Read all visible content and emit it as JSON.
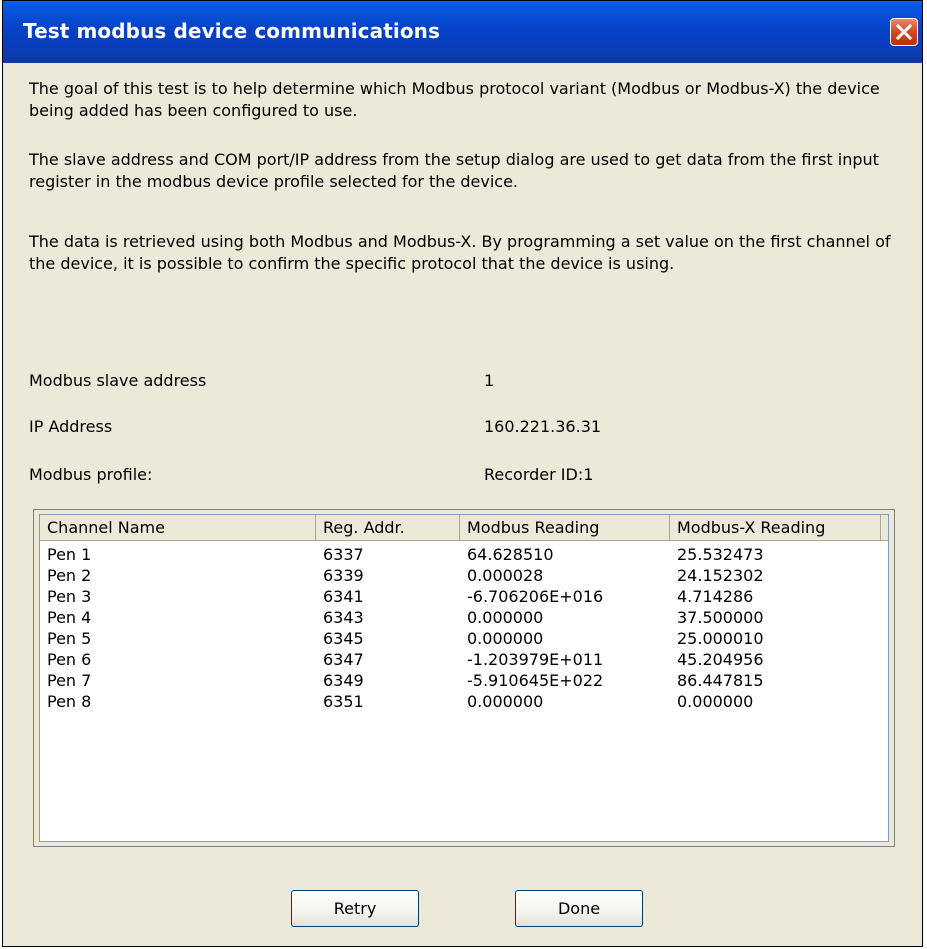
{
  "dialog": {
    "title": "Test modbus device communications",
    "paragraphs": [
      "The goal of this test is to help determine which Modbus protocol variant (Modbus or Modbus-X) the device being added has been configured to use.",
      "The slave address and COM port/IP address from the setup dialog are used to get data from the first input register in the modbus device profile selected for the device.",
      "The data is retrieved using both Modbus and Modbus-X. By programming a set value on the first channel of the device, it is possible to confirm the specific protocol that the device is using."
    ]
  },
  "fields": {
    "slave_label": "Modbus slave address",
    "slave_value": "1",
    "ip_label": "IP Address",
    "ip_value": "160.221.36.31",
    "profile_label": "Modbus profile:",
    "profile_value": "Recorder ID:1"
  },
  "table": {
    "headers": [
      "Channel Name",
      "Reg. Addr.",
      "Modbus Reading",
      "Modbus-X Reading"
    ],
    "rows": [
      [
        "Pen 1",
        "6337",
        "64.628510",
        "25.532473"
      ],
      [
        "Pen 2",
        "6339",
        "0.000028",
        "24.152302"
      ],
      [
        "Pen 3",
        "6341",
        "-6.706206E+016",
        "4.714286"
      ],
      [
        "Pen 4",
        "6343",
        "0.000000",
        "37.500000"
      ],
      [
        "Pen 5",
        "6345",
        "0.000000",
        "25.000010"
      ],
      [
        "Pen 6",
        "6347",
        "-1.203979E+011",
        "45.204956"
      ],
      [
        "Pen 7",
        "6349",
        "-5.910645E+022",
        "86.447815"
      ],
      [
        "Pen 8",
        "6351",
        "0.000000",
        "0.000000"
      ]
    ]
  },
  "buttons": {
    "retry": "Retry",
    "done": "Done"
  },
  "icons": {
    "close": "close-icon"
  },
  "colors": {
    "titlebar": "#0a48d8",
    "dialog_bg": "#ece9d8",
    "close_button": "#d1451f"
  }
}
